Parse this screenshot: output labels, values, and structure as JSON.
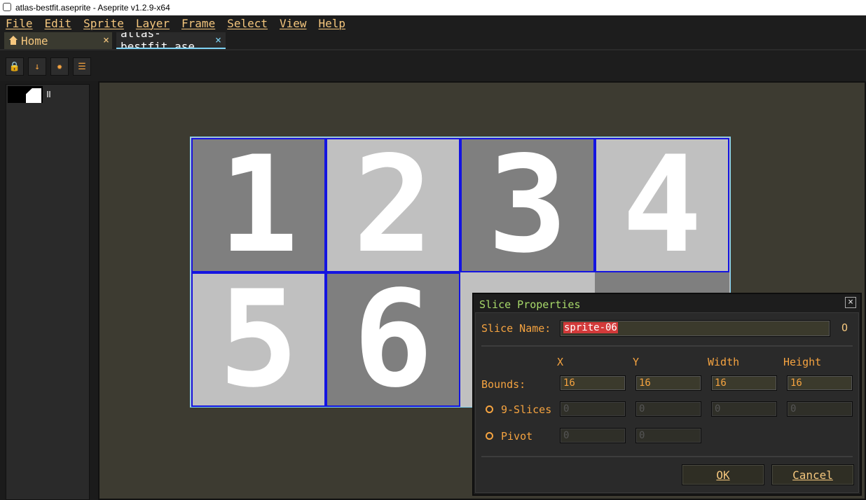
{
  "window": {
    "title": "atlas-bestfit.aseprite - Aseprite v1.2.9-x64"
  },
  "menu": [
    "File",
    "Edit",
    "Sprite",
    "Layer",
    "Frame",
    "Select",
    "View",
    "Help"
  ],
  "tabs": [
    {
      "label": "Home",
      "close": "×"
    },
    {
      "label": "atlas-bestfit.ase",
      "close": "×"
    }
  ],
  "toolbar": {
    "icons": [
      "lock-icon",
      "arrow-down-icon",
      "gear-icon",
      "menu-icon"
    ],
    "glyphs": [
      "🔒",
      "↓",
      "✹",
      "☰"
    ]
  },
  "sprite_cells": [
    "1",
    "2",
    "3",
    "4",
    "5",
    "6"
  ],
  "dialog": {
    "title": "Slice Properties",
    "close": "×",
    "slice_name_label": "Slice Name:",
    "slice_name_value": "sprite-06",
    "color_indicator": "O",
    "columns": [
      "X",
      "Y",
      "Width",
      "Height"
    ],
    "bounds_label": "Bounds:",
    "bounds": [
      "16",
      "16",
      "16",
      "16"
    ],
    "nine_slices_label": "9-Slices",
    "nine_slices": [
      "0",
      "0",
      "0",
      "0"
    ],
    "pivot_label": "Pivot",
    "pivot": [
      "0",
      "0"
    ],
    "ok_label": "OK",
    "cancel_label": "Cancel"
  },
  "colors": {
    "accent": "#f5a340",
    "menu_text": "#f5c77e",
    "title_green": "#a8d96a",
    "selection_blue": "#1414e0"
  }
}
